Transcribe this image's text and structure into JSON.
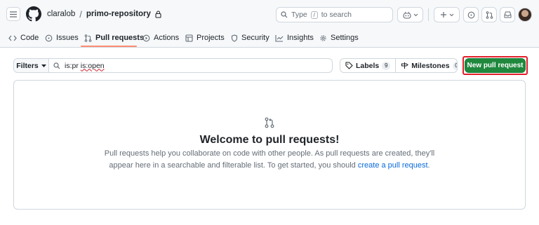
{
  "header": {
    "owner": "claralob",
    "separator": "/",
    "repo": "primo-repository",
    "search_prefix": "Type",
    "search_key": "/",
    "search_suffix": "to search"
  },
  "tabs": [
    {
      "label": "Code"
    },
    {
      "label": "Issues"
    },
    {
      "label": "Pull requests"
    },
    {
      "label": "Actions"
    },
    {
      "label": "Projects"
    },
    {
      "label": "Security"
    },
    {
      "label": "Insights"
    },
    {
      "label": "Settings"
    }
  ],
  "filters": {
    "button_label": "Filters",
    "query_part1": "is:pr",
    "query_part2": "is:open"
  },
  "labels": {
    "label": "Labels",
    "count": "9"
  },
  "milestones": {
    "label": "Milestones",
    "count": "0"
  },
  "new_pr": {
    "label": "New pull request"
  },
  "blankslate": {
    "title": "Welcome to pull requests!",
    "text": "Pull requests help you collaborate on code with other people. As pull requests are created, they'll appear here in a searchable and filterable list. To get started, you should",
    "link": "create a pull request",
    "end": "."
  },
  "colors": {
    "primary_button": "#1f883d",
    "link": "#0969da",
    "active_tab_underline": "#fd8c73",
    "highlight_box": "#e11d2a"
  }
}
